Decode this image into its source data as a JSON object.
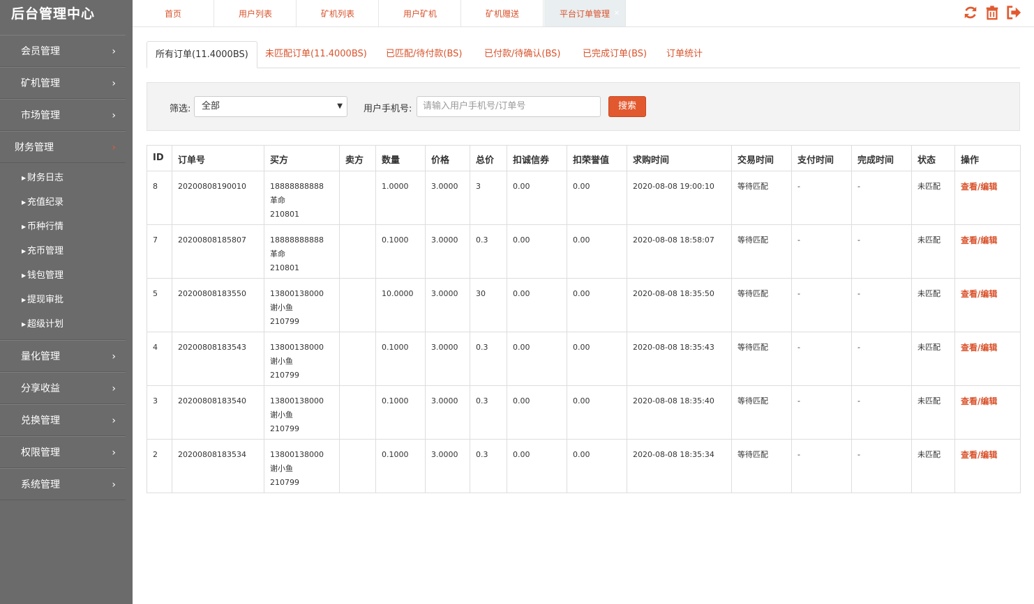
{
  "brand": "后台管理中心",
  "sidebar": {
    "items_top": [
      {
        "label": "会员管理"
      },
      {
        "label": "矿机管理"
      },
      {
        "label": "市场管理"
      }
    ],
    "open_item": {
      "label": "财务管理"
    },
    "sub_items": [
      {
        "label": "财务日志"
      },
      {
        "label": "充值纪录"
      },
      {
        "label": "币种行情"
      },
      {
        "label": "充币管理"
      },
      {
        "label": "钱包管理"
      },
      {
        "label": "提现审批"
      },
      {
        "label": "超级计划"
      }
    ],
    "items_bottom": [
      {
        "label": "量化管理"
      },
      {
        "label": "分享收益"
      },
      {
        "label": "兑换管理"
      },
      {
        "label": "权限管理"
      },
      {
        "label": "系统管理"
      }
    ]
  },
  "top_tabs": [
    {
      "label": "首页"
    },
    {
      "label": "用户列表"
    },
    {
      "label": "矿机列表"
    },
    {
      "label": "用户矿机"
    },
    {
      "label": "矿机赠送"
    },
    {
      "label": "平台订单管理"
    }
  ],
  "top_icons": [
    "refresh-icon",
    "trash-icon",
    "logout-icon"
  ],
  "colors": {
    "accent": "#d9532c",
    "sidebar": "#6b6b6b",
    "button": "#e2592f"
  },
  "sub_tabs": [
    {
      "label": "所有订单(11.4000BS)"
    },
    {
      "label": "未匹配订单(11.4000BS)"
    },
    {
      "label": "已匹配/待付款(BS)"
    },
    {
      "label": "已付款/待确认(BS)"
    },
    {
      "label": "已完成订单(BS)"
    },
    {
      "label": "订单统计"
    }
  ],
  "filter": {
    "label": "筛选:",
    "selected": "全部",
    "phone_label": "用户手机号:",
    "phone_placeholder": "请输入用户手机号/订单号",
    "search_button": "搜索"
  },
  "table": {
    "headers": [
      "ID",
      "订单号",
      "买方",
      "卖方",
      "数量",
      "价格",
      "总价",
      "扣诚信券",
      "扣荣誉值",
      "求购时间",
      "交易时间",
      "支付时间",
      "完成时间",
      "状态",
      "操作"
    ],
    "rows": [
      {
        "id": "8",
        "order": "20200808190010",
        "buyer_phone": "18888888888",
        "buyer_name": "革命",
        "buyer_code": "210801",
        "seller": "",
        "qty": "1.0000",
        "price": "3.0000",
        "total": "3",
        "coupon": "0.00",
        "honor": "0.00",
        "req_time": "2020-08-08 19:00:10",
        "trade_time": "等待匹配",
        "pay_time": "-",
        "done_time": "-",
        "status": "未匹配",
        "op": "查看/编辑"
      },
      {
        "id": "7",
        "order": "20200808185807",
        "buyer_phone": "18888888888",
        "buyer_name": "革命",
        "buyer_code": "210801",
        "seller": "",
        "qty": "0.1000",
        "price": "3.0000",
        "total": "0.3",
        "coupon": "0.00",
        "honor": "0.00",
        "req_time": "2020-08-08 18:58:07",
        "trade_time": "等待匹配",
        "pay_time": "-",
        "done_time": "-",
        "status": "未匹配",
        "op": "查看/编辑"
      },
      {
        "id": "5",
        "order": "20200808183550",
        "buyer_phone": "13800138000",
        "buyer_name": "谢小鱼",
        "buyer_code": "210799",
        "seller": "",
        "qty": "10.0000",
        "price": "3.0000",
        "total": "30",
        "coupon": "0.00",
        "honor": "0.00",
        "req_time": "2020-08-08 18:35:50",
        "trade_time": "等待匹配",
        "pay_time": "-",
        "done_time": "-",
        "status": "未匹配",
        "op": "查看/编辑"
      },
      {
        "id": "4",
        "order": "20200808183543",
        "buyer_phone": "13800138000",
        "buyer_name": "谢小鱼",
        "buyer_code": "210799",
        "seller": "",
        "qty": "0.1000",
        "price": "3.0000",
        "total": "0.3",
        "coupon": "0.00",
        "honor": "0.00",
        "req_time": "2020-08-08 18:35:43",
        "trade_time": "等待匹配",
        "pay_time": "-",
        "done_time": "-",
        "status": "未匹配",
        "op": "查看/编辑"
      },
      {
        "id": "3",
        "order": "20200808183540",
        "buyer_phone": "13800138000",
        "buyer_name": "谢小鱼",
        "buyer_code": "210799",
        "seller": "",
        "qty": "0.1000",
        "price": "3.0000",
        "total": "0.3",
        "coupon": "0.00",
        "honor": "0.00",
        "req_time": "2020-08-08 18:35:40",
        "trade_time": "等待匹配",
        "pay_time": "-",
        "done_time": "-",
        "status": "未匹配",
        "op": "查看/编辑"
      },
      {
        "id": "2",
        "order": "20200808183534",
        "buyer_phone": "13800138000",
        "buyer_name": "谢小鱼",
        "buyer_code": "210799",
        "seller": "",
        "qty": "0.1000",
        "price": "3.0000",
        "total": "0.3",
        "coupon": "0.00",
        "honor": "0.00",
        "req_time": "2020-08-08 18:35:34",
        "trade_time": "等待匹配",
        "pay_time": "-",
        "done_time": "-",
        "status": "未匹配",
        "op": "查看/编辑"
      }
    ]
  }
}
